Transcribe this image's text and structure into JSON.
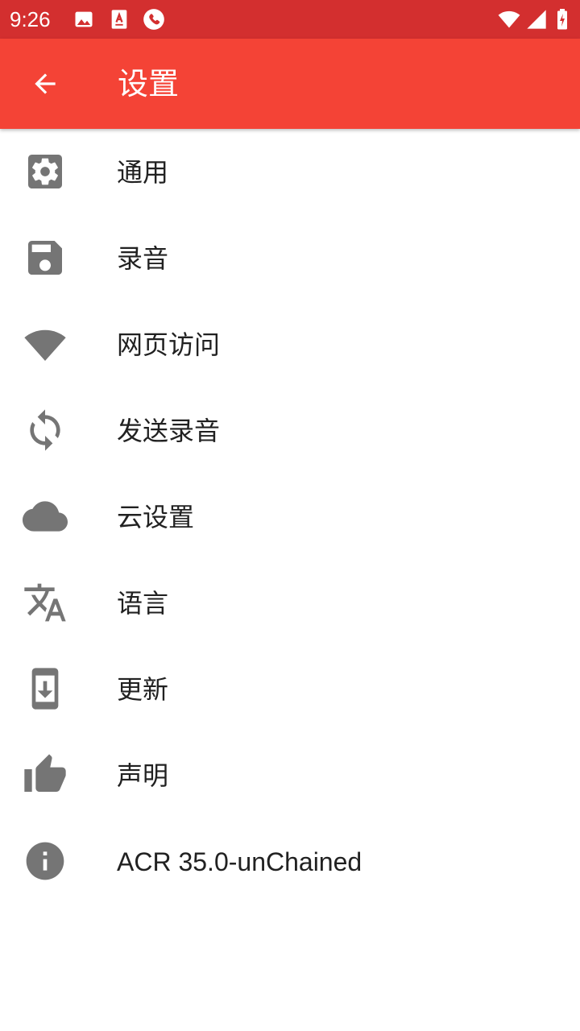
{
  "status_bar": {
    "time": "9:26",
    "color": "#d32f2f",
    "left_icons": [
      "image-notification-icon",
      "pdf-notification-icon",
      "phone-call-icon"
    ],
    "right_icons": [
      "wifi-icon",
      "signal-icon",
      "battery-charging-icon"
    ]
  },
  "app_bar": {
    "title": "设置",
    "back_icon": "arrow-back-icon",
    "color": "#f44336"
  },
  "settings": {
    "items": [
      {
        "label": "通用",
        "icon": "gear-icon"
      },
      {
        "label": "录音",
        "icon": "save-icon"
      },
      {
        "label": "网页访问",
        "icon": "wifi-icon"
      },
      {
        "label": "发送录音",
        "icon": "sync-icon"
      },
      {
        "label": "云设置",
        "icon": "cloud-icon"
      },
      {
        "label": "语言",
        "icon": "translate-icon"
      },
      {
        "label": "更新",
        "icon": "system-update-icon"
      },
      {
        "label": "声明",
        "icon": "thumb-up-icon"
      },
      {
        "label": "ACR 35.0-unChained",
        "icon": "info-icon"
      }
    ],
    "icon_color": "#757575",
    "text_color": "#212121"
  }
}
